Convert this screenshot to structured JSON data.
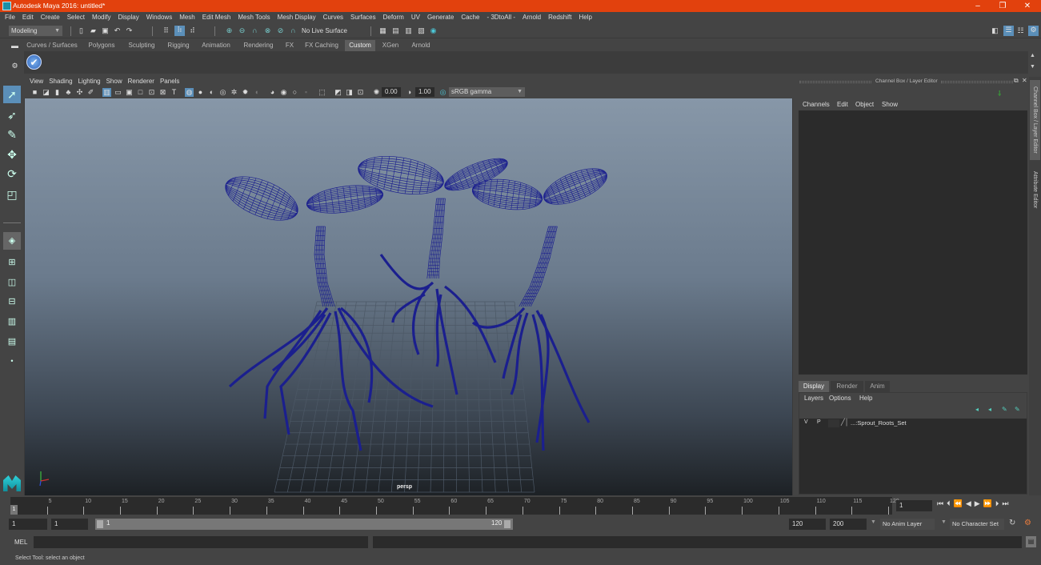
{
  "title": {
    "app": "Autodesk Maya 2016: untitled*",
    "minimize": "–",
    "maximize": "❐",
    "close": "✕"
  },
  "menubar": [
    "File",
    "Edit",
    "Create",
    "Select",
    "Modify",
    "Display",
    "Windows",
    "Mesh",
    "Edit Mesh",
    "Mesh Tools",
    "Mesh Display",
    "Curves",
    "Surfaces",
    "Deform",
    "UV",
    "Generate",
    "Cache",
    "- 3DtoAll -",
    "Arnold",
    "Redshift",
    "Help"
  ],
  "statusline": {
    "mode": "Modeling",
    "live_surface": "No Live Surface"
  },
  "shelf": {
    "tabs": [
      "Curves / Surfaces",
      "Polygons",
      "Sculpting",
      "Rigging",
      "Animation",
      "Rendering",
      "FX",
      "FX Caching",
      "Custom",
      "XGen",
      "Arnold"
    ],
    "active_tab": "Custom"
  },
  "viewport": {
    "menu": [
      "View",
      "Shading",
      "Lighting",
      "Show",
      "Renderer",
      "Panels"
    ],
    "exposure": "0.00",
    "gamma": "1.00",
    "color_space": "sRGB gamma",
    "camera_label": "persp"
  },
  "channel_box": {
    "title": "Channel Box / Layer Editor",
    "menu": [
      "Channels",
      "Edit",
      "Object",
      "Show"
    ]
  },
  "layer_editor": {
    "tabs": [
      "Display",
      "Render",
      "Anim"
    ],
    "active_tab": "Display",
    "menu": [
      "Layers",
      "Options",
      "Help"
    ],
    "layers": [
      {
        "v": "V",
        "p": "P",
        "name": "...:Sprout_Roots_Set"
      }
    ]
  },
  "side_tabs": [
    "Channel Box / Layer Editor",
    "Attribute Editor"
  ],
  "timeline": {
    "ticks": [
      5,
      10,
      15,
      20,
      25,
      30,
      35,
      40,
      45,
      50,
      55,
      60,
      65,
      70,
      75,
      80,
      85,
      90,
      95,
      100,
      105,
      110,
      115,
      120
    ],
    "current_frame": "1",
    "current_frame_field": "1"
  },
  "range": {
    "start": "1",
    "anim_start": "1",
    "slider_start": "1",
    "slider_end": "120",
    "anim_end": "120",
    "end": "200",
    "anim_layer": "No Anim Layer",
    "character_set": "No Character Set"
  },
  "command_line": {
    "label": "MEL"
  },
  "help_line": "Select Tool: select an object"
}
